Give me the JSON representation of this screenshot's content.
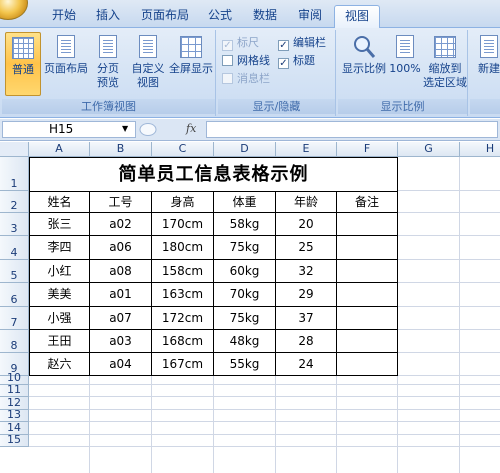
{
  "ribbon": {
    "tabs": [
      "开始",
      "插入",
      "页面布局",
      "公式",
      "数据",
      "审阅",
      "视图"
    ],
    "active_tab": "视图",
    "groups": {
      "workbook_views": {
        "label": "工作簿视图",
        "buttons": {
          "normal": "普通",
          "page_layout": "页面布局",
          "page_break_1": "分页",
          "page_break_2": "预览",
          "custom_1": "自定义",
          "custom_2": "视图",
          "fullscreen": "全屏显示"
        }
      },
      "show_hide": {
        "label": "显示/隐藏",
        "checkboxes": {
          "ruler": "标尺",
          "gridlines": "网格线",
          "messagebar": "消息栏",
          "formulabar": "编辑栏",
          "headings": "标题"
        }
      },
      "zoom": {
        "label": "显示比例",
        "buttons": {
          "zoom": "显示比例",
          "zoom100": "100%",
          "zoom_selection_1": "缩放到",
          "zoom_selection_2": "选定区域"
        }
      },
      "window": {
        "buttons": {
          "new_window": "新建"
        }
      }
    }
  },
  "formula_bar": {
    "name_box": "H15",
    "fx": "fx",
    "content": ""
  },
  "sheet": {
    "columns": [
      "A",
      "B",
      "C",
      "D",
      "E",
      "F",
      "G",
      "H"
    ],
    "rows": [
      "1",
      "2",
      "3",
      "4",
      "5",
      "6",
      "7",
      "8",
      "9",
      "10",
      "11",
      "12",
      "13",
      "14",
      "15"
    ],
    "title": "简单员工信息表格示例",
    "headers": [
      "姓名",
      "工号",
      "身高",
      "体重",
      "年龄",
      "备注"
    ],
    "data": [
      [
        "张三",
        "a02",
        "170cm",
        "58kg",
        "20",
        ""
      ],
      [
        "李四",
        "a06",
        "180cm",
        "75kg",
        "25",
        ""
      ],
      [
        "小红",
        "a08",
        "158cm",
        "60kg",
        "32",
        ""
      ],
      [
        "美美",
        "a01",
        "163cm",
        "70kg",
        "29",
        ""
      ],
      [
        "小强",
        "a07",
        "172cm",
        "75kg",
        "37",
        ""
      ],
      [
        "王田",
        "a03",
        "168cm",
        "48kg",
        "28",
        ""
      ],
      [
        "赵六",
        "a04",
        "167cm",
        "55kg",
        "24",
        ""
      ]
    ]
  }
}
